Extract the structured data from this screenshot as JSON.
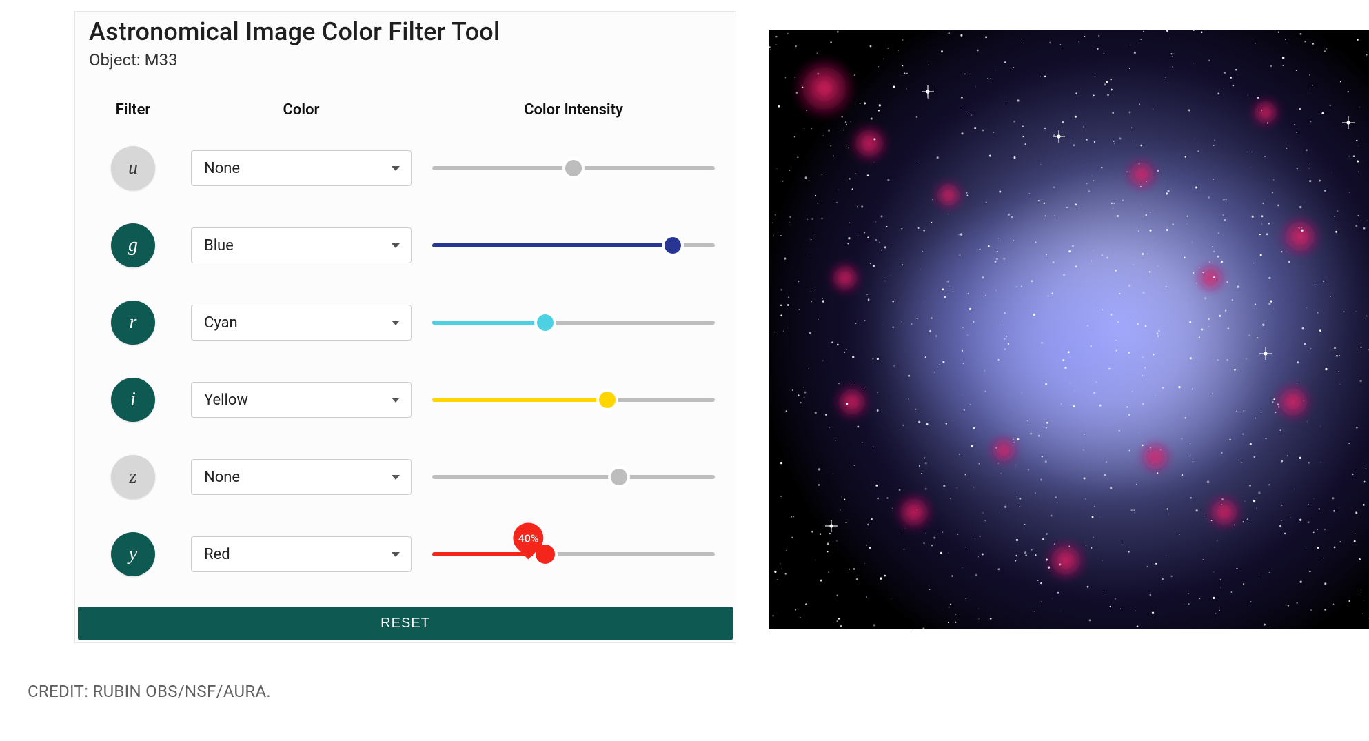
{
  "title": "Astronomical Image Color Filter Tool",
  "object_label_prefix": "Object: ",
  "object_name": "M33",
  "columns": {
    "filter": "Filter",
    "color": "Color",
    "intensity": "Color Intensity"
  },
  "reset_label": "RESET",
  "credit": "CREDIT: RUBIN OBS/NSF/AURA.",
  "colors": {
    "none": "#bdbdbd",
    "blue": "#283593",
    "cyan": "#4dd0e1",
    "yellow": "#ffd600",
    "red": "#f4251b"
  },
  "filters": [
    {
      "band": "u",
      "active": false,
      "color_key": "none",
      "color_label": "None",
      "intensity": 50,
      "show_value": false
    },
    {
      "band": "g",
      "active": true,
      "color_key": "blue",
      "color_label": "Blue",
      "intensity": 85,
      "show_value": false
    },
    {
      "band": "r",
      "active": true,
      "color_key": "cyan",
      "color_label": "Cyan",
      "intensity": 40,
      "show_value": false
    },
    {
      "band": "i",
      "active": true,
      "color_key": "yellow",
      "color_label": "Yellow",
      "intensity": 62,
      "show_value": false
    },
    {
      "band": "z",
      "active": false,
      "color_key": "none",
      "color_label": "None",
      "intensity": 66,
      "show_value": false
    },
    {
      "band": "y",
      "active": true,
      "color_key": "red",
      "color_label": "Red",
      "intensity": 40,
      "show_value": true,
      "value_text": "40%"
    }
  ]
}
